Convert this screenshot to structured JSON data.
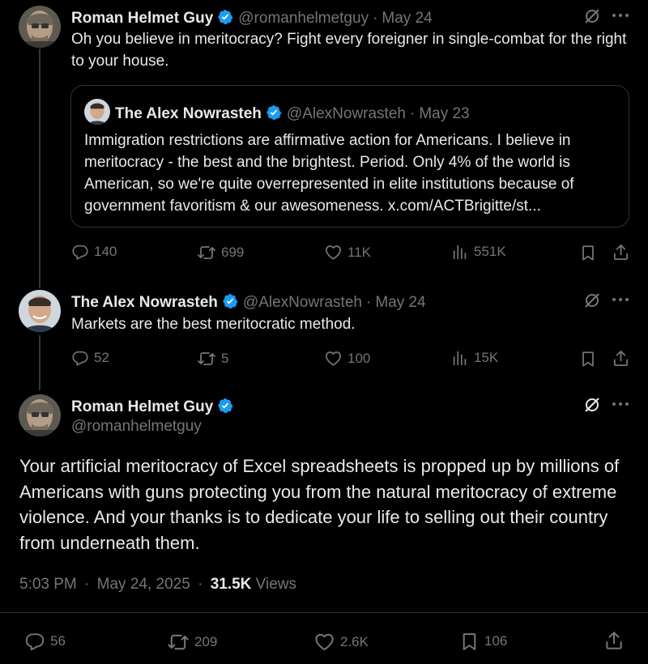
{
  "tweet1": {
    "name": "Roman Helmet Guy",
    "handle": "@romanhelmetguy",
    "date": "May 24",
    "text": "Oh you believe in meritocracy? Fight every foreigner in single-combat for the right to your house.",
    "quote": {
      "name": "The Alex Nowrasteh",
      "handle": "@AlexNowrasteh",
      "date": "May 23",
      "text": "Immigration restrictions are affirmative action for Americans. I believe in meritocracy - the best and the brightest. Period. Only 4% of the world is American, so we're quite overrepresented in elite institutions because of government favoritism & our awesomeness. x.com/ACTBrigitte/st..."
    },
    "replies": "140",
    "reposts": "699",
    "likes": "11K",
    "views": "551K"
  },
  "tweet2": {
    "name": "The Alex Nowrasteh",
    "handle": "@AlexNowrasteh",
    "date": "May 24",
    "text": "Markets are the best meritocratic method.",
    "replies": "52",
    "reposts": "5",
    "likes": "100",
    "views": "15K"
  },
  "main": {
    "name": "Roman Helmet Guy",
    "handle": "@romanhelmetguy",
    "text": "Your artificial meritocracy of Excel spreadsheets is propped up by millions of Americans with guns protecting you from the natural meritocracy of extreme violence. And your thanks is to dedicate your life to selling out their country from underneath them.",
    "time": "5:03 PM",
    "date": "May 24, 2025",
    "views_count": "31.5K",
    "views_label": "Views",
    "replies": "56",
    "reposts": "209",
    "likes": "2.6K",
    "bookmarks": "106"
  },
  "separator": "·",
  "icons": {
    "verified": "verified-badge-icon",
    "grok": "grok-icon",
    "more": "more-icon",
    "reply": "reply-icon",
    "repost": "repost-icon",
    "like": "like-icon",
    "views": "views-icon",
    "bookmark": "bookmark-icon",
    "share": "share-icon"
  },
  "colors": {
    "background": "#000000",
    "text": "#e7e9ea",
    "muted": "#71767b",
    "verified": "#1d9bf0",
    "border": "#2f3336"
  }
}
